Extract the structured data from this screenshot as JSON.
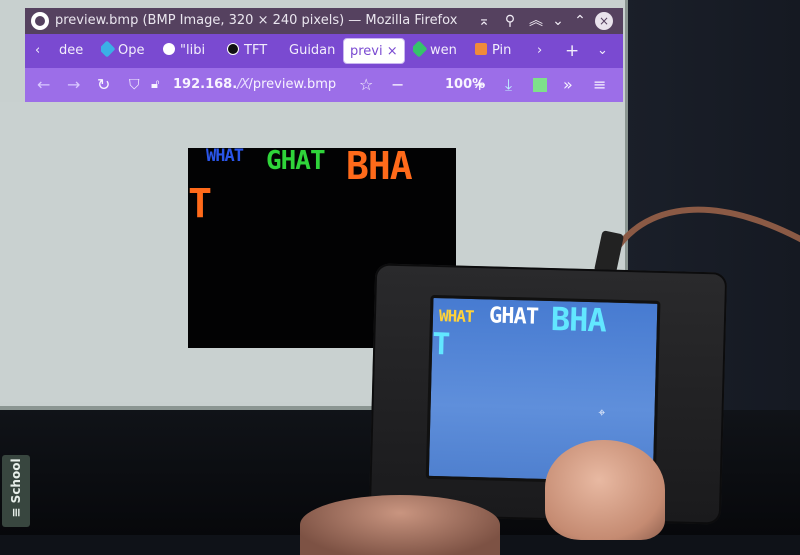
{
  "browser": {
    "window_title": "preview.bmp (BMP Image, 320 × 240 pixels) — Mozilla Firefox",
    "controls": [
      "⌅",
      "⚲",
      "︽",
      "⌄",
      "⌃"
    ],
    "tabs": [
      {
        "label": "‹",
        "icon_color": ""
      },
      {
        "label": "dee",
        "icon_color": ""
      },
      {
        "label": "Ope",
        "icon_color": "#3bb0e6"
      },
      {
        "label": "\"libi",
        "icon_color": "#ffffff"
      },
      {
        "label": "TFT",
        "icon_color": "#111111"
      },
      {
        "label": "Guidan",
        "icon_color": ""
      },
      {
        "label": "previ",
        "icon_color": "",
        "active": true,
        "close": "×"
      },
      {
        "label": "wen",
        "icon_color": "#35c46a"
      },
      {
        "label": "Pin",
        "icon_color": "#f08a3a"
      },
      {
        "label": "›",
        "icon_color": ""
      },
      {
        "label": "+",
        "icon_color": ""
      },
      {
        "label": "⌄",
        "icon_color": ""
      }
    ],
    "nav": {
      "back": "←",
      "forward": "→",
      "reload": "↻",
      "url_host": "192.168.",
      "url_mask": "/X",
      "url_path": "/preview.bmp",
      "bookmark": "☆",
      "zoom_out": "−",
      "zoom": "100%",
      "zoom_in": "+",
      "download": "⤓",
      "overflow": "»",
      "menu": "≡"
    }
  },
  "bmp_preview": {
    "words": [
      {
        "text": "WHAT",
        "color": "#2a55e8"
      },
      {
        "text": "GHAT",
        "color": "#2fd43a"
      },
      {
        "text": "BHA",
        "color": "#ff6a1a"
      },
      {
        "text": "T",
        "color": "#ff6a1a"
      }
    ]
  },
  "device_screen": {
    "words": [
      {
        "text": "WHAT",
        "color": "#ffd23a"
      },
      {
        "text": "GHAT",
        "color": "#ffffff"
      },
      {
        "text": "BHA",
        "color": "#62e7ff"
      },
      {
        "text": "T",
        "color": "#62e7ff"
      }
    ],
    "cursor": "⌖"
  },
  "side_tab": {
    "icon": "≡",
    "label": "School"
  }
}
